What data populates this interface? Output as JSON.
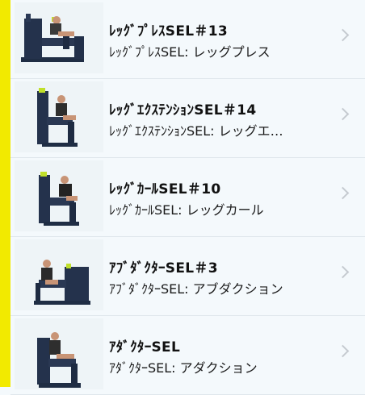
{
  "accent_color": "#f2ea00",
  "items": [
    {
      "title": "ﾚｯｸﾞﾌﾟﾚｽSEL＃13",
      "subtitle": "ﾚｯｸﾞﾌﾟﾚｽSEL: レッグプレス",
      "image": "leg-press-machine-image",
      "icon": "chevron-right-icon"
    },
    {
      "title": "ﾚｯｸﾞｴｸｽﾃﾝｼｮﾝSEL＃14",
      "subtitle": "ﾚｯｸﾞｴｸｽﾃﾝｼｮﾝSEL: レッグエ…",
      "image": "leg-extension-machine-image",
      "icon": "chevron-right-icon"
    },
    {
      "title": "ﾚｯｸﾞｶｰﾙSEL＃10",
      "subtitle": "ﾚｯｸﾞｶｰﾙSEL: レッグカール",
      "image": "leg-curl-machine-image",
      "icon": "chevron-right-icon"
    },
    {
      "title": "ｱﾌﾞﾀﾞｸﾀｰSEL＃3",
      "subtitle": "ｱﾌﾞﾀﾞｸﾀｰSEL: アブダクション",
      "image": "abductor-machine-image",
      "icon": "chevron-right-icon"
    },
    {
      "title": "ｱﾀﾞｸﾀｰSEL",
      "subtitle": "ｱﾀﾞｸﾀｰSEL: アダクション",
      "image": "adductor-machine-image",
      "icon": "chevron-right-icon"
    }
  ]
}
